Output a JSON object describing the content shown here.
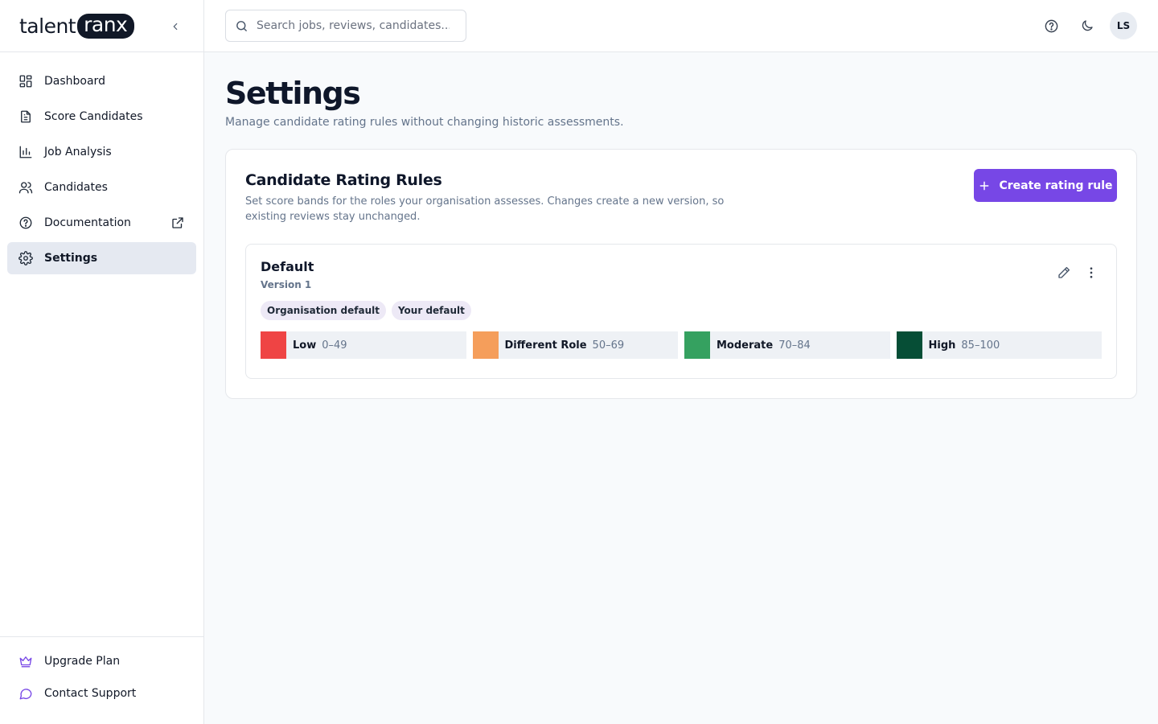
{
  "brand": {
    "part1": "talent",
    "part2": "ranx"
  },
  "sidebar": {
    "items": [
      {
        "label": "Dashboard",
        "icon": "dashboard-icon"
      },
      {
        "label": "Score Candidates",
        "icon": "document-icon"
      },
      {
        "label": "Job Analysis",
        "icon": "bar-chart-icon"
      },
      {
        "label": "Candidates",
        "icon": "users-icon"
      },
      {
        "label": "Documentation",
        "icon": "help-circle-icon"
      },
      {
        "label": "Settings",
        "icon": "gear-icon",
        "active": true
      }
    ],
    "bottom": [
      {
        "label": "Upgrade Plan",
        "icon": "crown-icon"
      },
      {
        "label": "Contact Support",
        "icon": "chat-icon"
      }
    ]
  },
  "header": {
    "search_placeholder": "Search jobs, reviews, candidates...",
    "avatar_initials": "LS"
  },
  "page": {
    "title": "Settings",
    "subtitle": "Manage candidate rating rules without changing historic assessments."
  },
  "rules_card": {
    "title": "Candidate Rating Rules",
    "description": "Set score bands for the roles your organisation assesses. Changes create a new version, so existing reviews stay unchanged.",
    "create_label": "Create rating rule",
    "rule": {
      "name": "Default",
      "version": "Version 1",
      "badges": [
        "Organisation default",
        "Your default"
      ],
      "bands": [
        {
          "label": "Low",
          "range": "0–49",
          "color": "#ef4444"
        },
        {
          "label": "Different Role",
          "range": "50–69",
          "color": "#f59e5b"
        },
        {
          "label": "Moderate",
          "range": "70–84",
          "color": "#35a160"
        },
        {
          "label": "High",
          "range": "85–100",
          "color": "#064e36"
        }
      ]
    }
  },
  "colors": {
    "accent": "#7747e6",
    "active_nav": "#e5e9f1"
  }
}
